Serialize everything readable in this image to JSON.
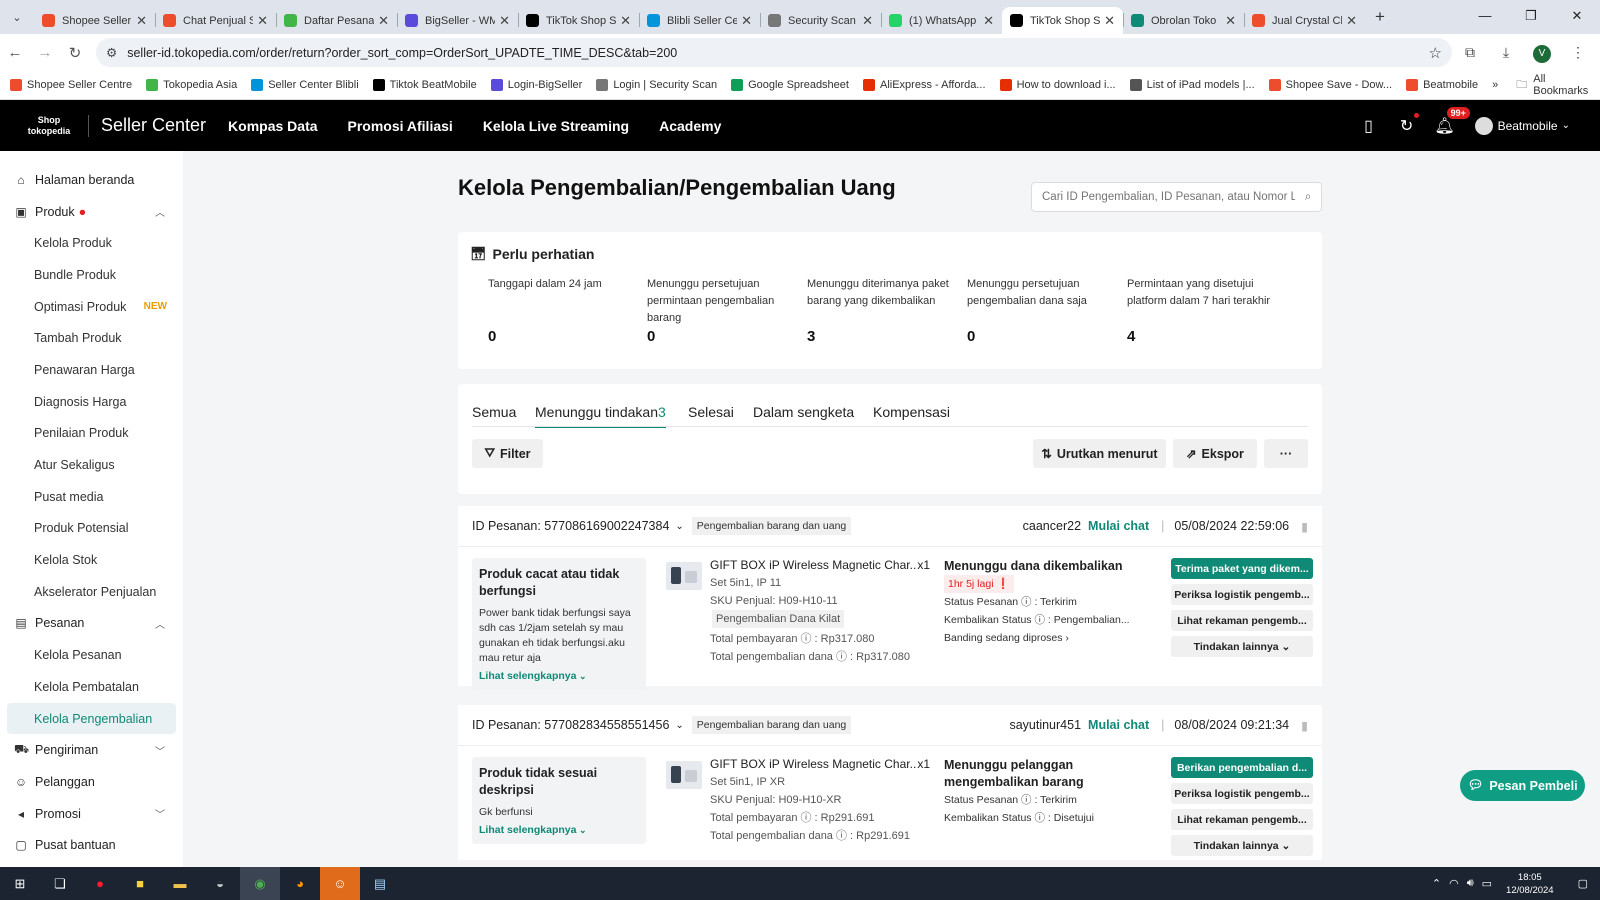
{
  "browser": {
    "tabs": [
      {
        "label": "Shopee Seller C",
        "color": "#ee4d2d",
        "icon": "shopee-icon"
      },
      {
        "label": "Chat Penjual Sh",
        "color": "#ee4d2d",
        "icon": "shopee-icon"
      },
      {
        "label": "Daftar Pesanan",
        "color": "#42b549",
        "icon": "tokopedia-icon"
      },
      {
        "label": "BigSeller - WM",
        "color": "#5b4bdb",
        "icon": "bigseller-icon"
      },
      {
        "label": "TikTok Shop Se",
        "color": "#000000",
        "icon": "tiktok-icon"
      },
      {
        "label": "Blibli Seller Cen",
        "color": "#0095da",
        "icon": "blibli-icon"
      },
      {
        "label": "Security Scan",
        "color": "#777777",
        "icon": "security-icon"
      },
      {
        "label": "(1) WhatsApp",
        "color": "#25d366",
        "icon": "whatsapp-icon"
      },
      {
        "label": "TikTok Shop Se",
        "color": "#000000",
        "icon": "tiktok-icon",
        "active": true
      },
      {
        "label": "Obrolan Toko",
        "color": "#0f8a76",
        "icon": "chat-icon"
      },
      {
        "label": "Jual Crystal Cle",
        "color": "#ee4d2d",
        "icon": "shopee-icon"
      }
    ],
    "url": "seller-id.tokopedia.com/order/return?order_sort_comp=OrderSort_UPADTE_TIME_DESC&tab=200",
    "profile_initial": "V",
    "bookmarks": [
      {
        "label": "Shopee Seller Centre",
        "color": "#ee4d2d"
      },
      {
        "label": "Tokopedia Asia",
        "color": "#42b549"
      },
      {
        "label": "Seller Center Blibli",
        "color": "#0095da"
      },
      {
        "label": "Tiktok BeatMobile",
        "color": "#000000"
      },
      {
        "label": "Login-BigSeller",
        "color": "#5b4bdb"
      },
      {
        "label": "Login | Security Scan",
        "color": "#777777"
      },
      {
        "label": "Google Spreadsheet",
        "color": "#0f9d58"
      },
      {
        "label": "AliExpress - Afforda...",
        "color": "#e62e04"
      },
      {
        "label": "How to download i...",
        "color": "#e62e04"
      },
      {
        "label": "List of iPad models |...",
        "color": "#555555"
      },
      {
        "label": "Shopee Save - Dow...",
        "color": "#ee4d2d"
      },
      {
        "label": "Beatmobile",
        "color": "#ee4d2d"
      }
    ],
    "all_bookmarks": "All Bookmarks"
  },
  "header": {
    "logo_line1": "Shop",
    "logo_line2": "tokopedia",
    "title": "Seller Center",
    "nav": [
      "Kompas Data",
      "Promosi Afiliasi",
      "Kelola Live Streaming",
      "Academy"
    ],
    "notif_count": "99+",
    "user": "Beatmobile"
  },
  "sidebar": {
    "items": [
      {
        "label": "Halaman beranda",
        "type": "top",
        "icon": "home-icon"
      },
      {
        "label": "Produk",
        "type": "top",
        "icon": "product-icon",
        "dot": "●",
        "chevron": "up"
      },
      {
        "label": "Kelola Produk",
        "type": "sub"
      },
      {
        "label": "Bundle Produk",
        "type": "sub"
      },
      {
        "label": "Optimasi Produk",
        "type": "sub",
        "badge": "NEW"
      },
      {
        "label": "Tambah Produk",
        "type": "sub"
      },
      {
        "label": "Penawaran Harga",
        "type": "sub"
      },
      {
        "label": "Diagnosis Harga",
        "type": "sub"
      },
      {
        "label": "Penilaian Produk",
        "type": "sub"
      },
      {
        "label": "Atur Sekaligus",
        "type": "sub"
      },
      {
        "label": "Pusat media",
        "type": "sub"
      },
      {
        "label": "Produk Potensial",
        "type": "sub"
      },
      {
        "label": "Kelola Stok",
        "type": "sub"
      },
      {
        "label": "Akselerator Penjualan",
        "type": "sub"
      },
      {
        "label": "Pesanan",
        "type": "top",
        "icon": "order-icon",
        "chevron": "up"
      },
      {
        "label": "Kelola Pesanan",
        "type": "sub"
      },
      {
        "label": "Kelola Pembatalan",
        "type": "sub"
      },
      {
        "label": "Kelola Pengembalian",
        "type": "sub",
        "active": true
      },
      {
        "label": "Pengiriman",
        "type": "top",
        "icon": "shipping-icon",
        "chevron": "down"
      },
      {
        "label": "Pelanggan",
        "type": "top",
        "icon": "customer-icon"
      },
      {
        "label": "Promosi",
        "type": "top",
        "icon": "promo-icon",
        "chevron": "down"
      },
      {
        "label": "Pusat bantuan",
        "type": "top",
        "icon": "help-icon"
      }
    ]
  },
  "page": {
    "title": "Kelola Pengembalian/Pengembalian Uang",
    "search_placeholder": "Cari ID Pengembalian, ID Pesanan, atau Nomor Lacak",
    "attention": {
      "title": "Perlu perhatian",
      "stats": [
        {
          "label": "Tanggapi dalam 24 jam",
          "value": "0"
        },
        {
          "label": "Menunggu persetujuan permintaan pengembalian barang",
          "value": "0"
        },
        {
          "label": "Menunggu diterimanya paket barang yang dikembalikan",
          "value": "3"
        },
        {
          "label": "Menunggu persetujuan pengembalian dana saja",
          "value": "0"
        },
        {
          "label": "Permintaan yang disetujui platform dalam 7 hari terakhir",
          "value": "4"
        }
      ]
    },
    "tabs": [
      {
        "label": "Semua",
        "count": ""
      },
      {
        "label": "Menunggu tindakan",
        "count": "3",
        "active": true
      },
      {
        "label": "Selesai",
        "count": ""
      },
      {
        "label": "Dalam sengketa",
        "count": ""
      },
      {
        "label": "Kompensasi",
        "count": ""
      }
    ],
    "filter_label": "Filter",
    "sort_label": "Urutkan menurut",
    "export_label": "Ekspor",
    "more_label": "···",
    "chat_fab": "Pesan Pembeli"
  },
  "orders": [
    {
      "order_id": "ID Pesanan: 577086169002247384",
      "type_tag": "Pengembalian barang dan uang",
      "buyer": "caancer22",
      "chat": "Mulai chat",
      "date": "05/08/2024 22:59:06",
      "reason_title": "Produk cacat atau tidak berfungsi",
      "reason_desc": "Power bank tidak berfungsi saya sdh cas 1/2jam setelah sy mau gunakan eh tidak berfungsi.aku mau retur aja",
      "see_more": "Lihat selengkapnya",
      "product_name": "GIFT BOX iP Wireless Magnetic Char...",
      "qty": "x1",
      "variant": "Set 5in1, IP 11",
      "sku": "SKU Penjual: H09-H10-11",
      "pill": "Pengembalian Dana Kilat",
      "total_pay": "Total pembayaran ⓘ : Rp317.080",
      "total_refund": "Total pengembalian dana ⓘ : Rp317.080",
      "status_title": "Menunggu dana dikembalikan",
      "late": "1hr 5j lagi ❗",
      "order_status": "Status Pesanan ⓘ : Terkirim",
      "return_status": "Kembalikan Status ⓘ : Pengembalian...",
      "appeal": "Banding sedang diproses  ›",
      "actions": [
        "Terima paket yang dikem...",
        "Periksa logistik pengemb...",
        "Lihat rekaman pengemb...",
        "Tindakan lainnya ⌄"
      ]
    },
    {
      "order_id": "ID Pesanan: 577082834558551456",
      "type_tag": "Pengembalian barang dan uang",
      "buyer": "sayutinur451",
      "chat": "Mulai chat",
      "date": "08/08/2024 09:21:34",
      "reason_title": "Produk tidak sesuai deskripsi",
      "reason_desc": "Gk berfunsi",
      "see_more": "Lihat selengkapnya",
      "product_name": "GIFT BOX iP Wireless Magnetic Char...",
      "qty": "x1",
      "variant": "Set 5in1, IP XR",
      "sku": "SKU Penjual: H09-H10-XR",
      "pill": "",
      "total_pay": "Total pembayaran ⓘ : Rp291.691",
      "total_refund": "Total pengembalian dana ⓘ : Rp291.691",
      "status_title": "Menunggu pelanggan mengembalikan barang",
      "late": "",
      "order_status": "Status Pesanan ⓘ : Terkirim",
      "return_status": "Kembalikan Status ⓘ : Disetujui",
      "appeal": "",
      "actions": [
        "Berikan pengembalian d...",
        "Periksa logistik pengemb...",
        "Lihat rekaman pengemb...",
        "Tindakan lainnya ⌄"
      ]
    }
  ],
  "taskbar": {
    "time": "18:05",
    "date": "12/08/2024"
  }
}
